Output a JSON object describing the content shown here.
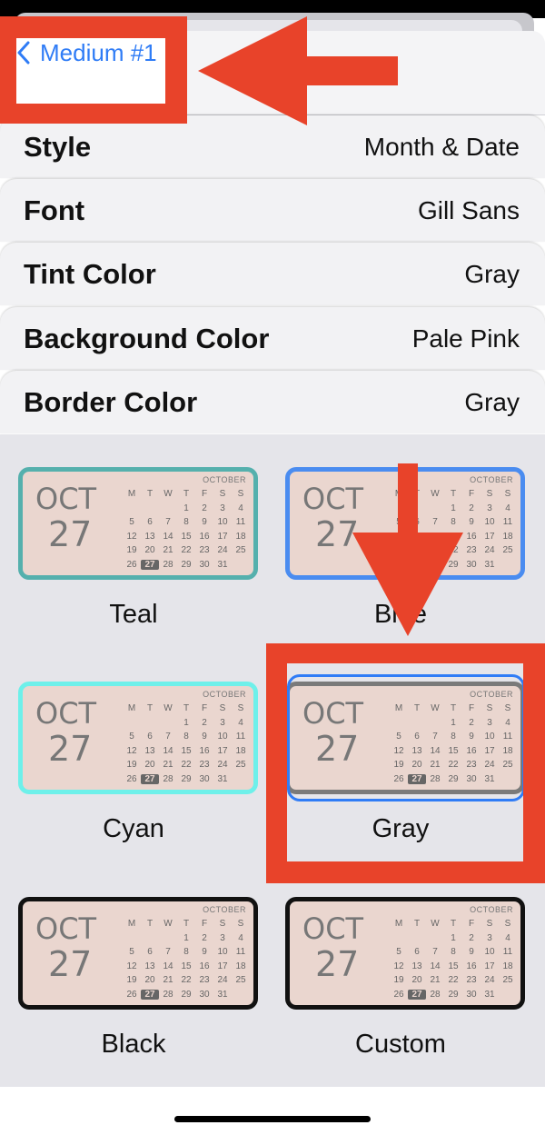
{
  "nav": {
    "back_label": "Medium #1"
  },
  "settings": [
    {
      "label": "Style",
      "value": "Month & Date"
    },
    {
      "label": "Font",
      "value": "Gill Sans"
    },
    {
      "label": "Tint Color",
      "value": "Gray"
    },
    {
      "label": "Background Color",
      "value": "Pale Pink"
    },
    {
      "label": "Border Color",
      "value": "Gray"
    }
  ],
  "widget": {
    "month": "OCT",
    "day": "27",
    "calendar_title": "OCTOBER",
    "weekdays": [
      "M",
      "T",
      "W",
      "T",
      "F",
      "S",
      "S"
    ],
    "weeks": [
      [
        "",
        "",
        "",
        "",
        "1",
        "2",
        "3",
        "4"
      ],
      [
        "5",
        "6",
        "7",
        "8",
        "9",
        "10",
        "11"
      ],
      [
        "12",
        "13",
        "14",
        "15",
        "16",
        "17",
        "18"
      ],
      [
        "19",
        "20",
        "21",
        "22",
        "23",
        "24",
        "25"
      ],
      [
        "26",
        "27",
        "28",
        "29",
        "30",
        "31",
        ""
      ]
    ],
    "today": "27"
  },
  "border_options": [
    {
      "label": "Teal",
      "color": "#55b0ad",
      "selected": false
    },
    {
      "label": "Blue",
      "color": "#4a8cf0",
      "selected": false
    },
    {
      "label": "Cyan",
      "color": "#6ef0ea",
      "selected": false
    },
    {
      "label": "Gray",
      "color": "#7a7a7a",
      "selected": true
    },
    {
      "label": "Black",
      "color": "#111111",
      "selected": false
    },
    {
      "label": "Custom",
      "color": "#111111",
      "selected": false
    }
  ],
  "colors": {
    "accent": "#2f7cf6",
    "annotation": "#e8432a",
    "widget_background": "#ead6cf",
    "widget_text": "#777777"
  }
}
